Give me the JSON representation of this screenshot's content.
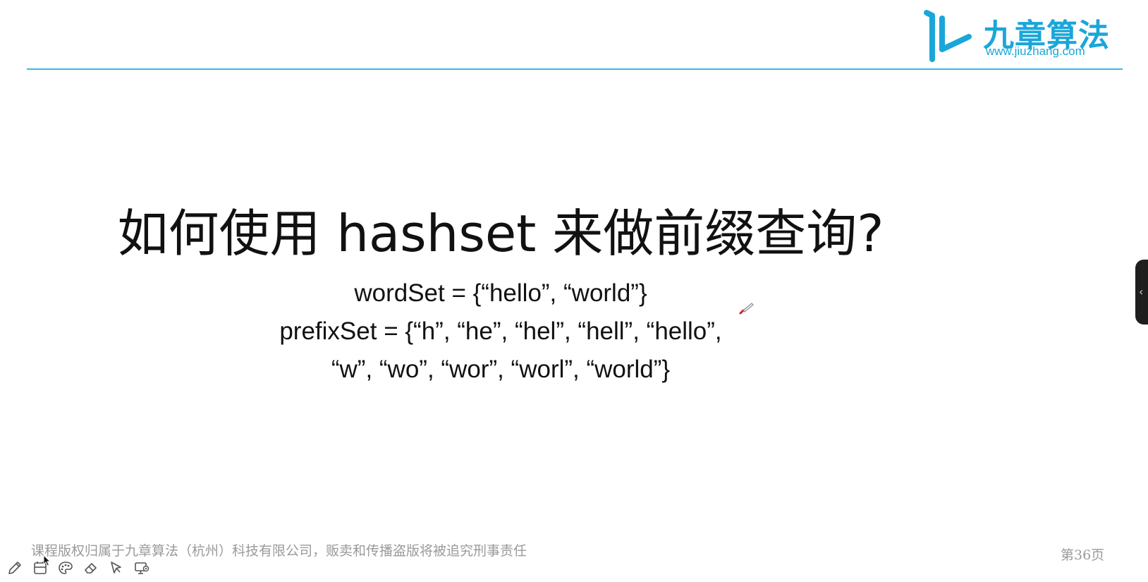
{
  "logo": {
    "name_cn": "九章算法",
    "url": "www.jiuzhang.com",
    "color": "#1aa6d9"
  },
  "slide": {
    "title": "如何使用 hashset 来做前缀查询?",
    "lines": [
      "wordSet = {“hello”, “world”}",
      "prefixSet = {“h”, “he”, “hel”, “hell”, “hello”,",
      "“w”, “wo”, “wor”, “worl”, “world”}"
    ],
    "footer": "课程版权归属于九章算法（杭州）科技有限公司，贩卖和传播盗版将被追究刑事责任",
    "page_number": "第36页",
    "accent_color": "#36b9e8"
  },
  "toolbar": {
    "tools": [
      {
        "icon": "pencil-icon"
      },
      {
        "icon": "whiteboard-icon"
      },
      {
        "icon": "palette-icon"
      },
      {
        "icon": "eraser-icon"
      },
      {
        "icon": "pointer-icon"
      },
      {
        "icon": "screen-share-icon"
      }
    ]
  },
  "side_panel": {
    "icon": "chevron-left-icon"
  }
}
